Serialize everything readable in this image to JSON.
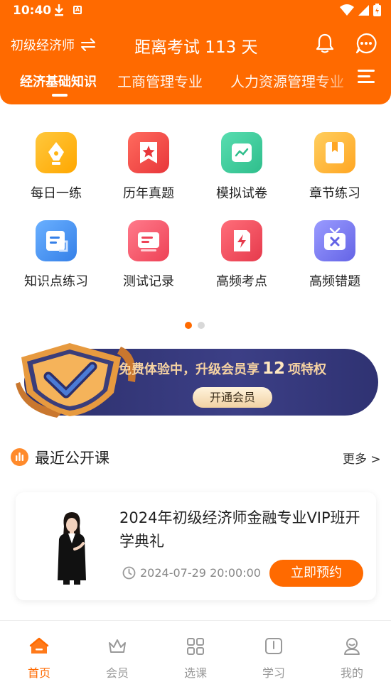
{
  "status_bar": {
    "time": "10:40"
  },
  "header": {
    "exam_type": "初级经济师",
    "countdown": "距离考试 113 天"
  },
  "tabs": [
    {
      "label": "经济基础知识"
    },
    {
      "label": "工商管理专业"
    },
    {
      "label": "人力资源管理专业"
    }
  ],
  "features": [
    {
      "label": "每日一练",
      "icon": "pen-nib-icon",
      "color": "#FFB515"
    },
    {
      "label": "历年真题",
      "icon": "star-book-icon",
      "color": "#F24D49"
    },
    {
      "label": "模拟试卷",
      "icon": "chart-tray-icon",
      "color": "#3FCE9E"
    },
    {
      "label": "章节练习",
      "icon": "bookmark-book-icon",
      "color": "#FFBB3D"
    },
    {
      "label": "知识点练习",
      "icon": "note-doc-icon",
      "color": "#4C96F2"
    },
    {
      "label": "测试记录",
      "icon": "record-card-icon",
      "color": "#F4566A"
    },
    {
      "label": "高频考点",
      "icon": "lightning-doc-icon",
      "color": "#F24D5E"
    },
    {
      "label": "高频错题",
      "icon": "wrong-tv-icon",
      "color": "#7B7BF0"
    }
  ],
  "banner": {
    "text_before": "免费体验中，升级会员享",
    "count": "12",
    "text_after": "项特权",
    "button": "开通会员"
  },
  "section": {
    "title": "最近公开课",
    "more": "更多 >"
  },
  "course": {
    "title": "2024年初级经济师金融专业VIP班开学典礼",
    "time": "2024-07-29 20:00:00",
    "button": "立即预约"
  },
  "bottom_nav": [
    {
      "label": "首页",
      "active": true
    },
    {
      "label": "会员",
      "active": false
    },
    {
      "label": "选课",
      "active": false
    },
    {
      "label": "学习",
      "active": false
    },
    {
      "label": "我的",
      "active": false
    }
  ]
}
